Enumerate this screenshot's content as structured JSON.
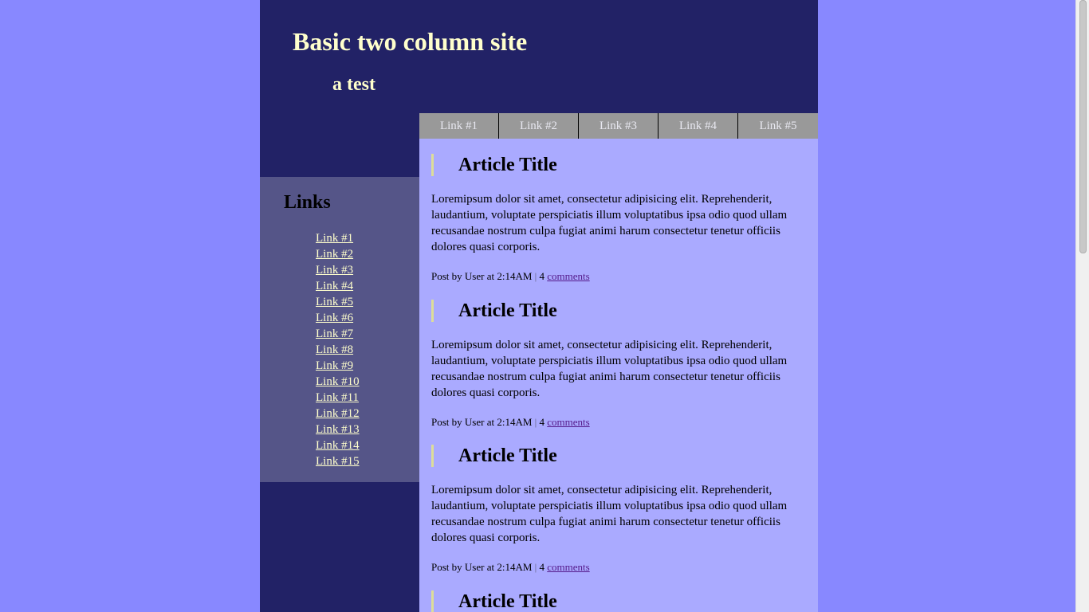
{
  "header": {
    "title": "Basic two column site",
    "subtitle": "a test"
  },
  "navbar": {
    "links": [
      "Link #1",
      "Link #2",
      "Link #3",
      "Link #4",
      "Link #5"
    ]
  },
  "sidebar": {
    "heading": "Links",
    "links": [
      "Link #1",
      "Link #2",
      "Link #3",
      "Link #4",
      "Link #5",
      "Link #6",
      "Link #7",
      "Link #8",
      "Link #9",
      "Link #10",
      "Link #11",
      "Link #12",
      "Link #13",
      "Link #14",
      "Link #15"
    ]
  },
  "articles": [
    {
      "title": "Article Title",
      "body": "Loremipsum dolor sit amet, consectetur adipisicing elit. Reprehenderit, laudantium, voluptate perspiciatis illum voluptatibus ipsa odio quod ullam recusandae nostrum culpa fugiat animi harum consectetur tenetur officiis dolores quasi corporis.",
      "meta_prefix": "Post by User at 2:14AM",
      "separator": "|",
      "comment_count": "4",
      "comments_label": "comments"
    },
    {
      "title": "Article Title",
      "body": "Loremipsum dolor sit amet, consectetur adipisicing elit. Reprehenderit, laudantium, voluptate perspiciatis illum voluptatibus ipsa odio quod ullam recusandae nostrum culpa fugiat animi harum consectetur tenetur officiis dolores quasi corporis.",
      "meta_prefix": "Post by User at 2:14AM",
      "separator": "|",
      "comment_count": "4",
      "comments_label": "comments"
    },
    {
      "title": "Article Title",
      "body": "Loremipsum dolor sit amet, consectetur adipisicing elit. Reprehenderit, laudantium, voluptate perspiciatis illum voluptatibus ipsa odio quod ullam recusandae nostrum culpa fugiat animi harum consectetur tenetur officiis dolores quasi corporis.",
      "meta_prefix": "Post by User at 2:14AM",
      "separator": "|",
      "comment_count": "4",
      "comments_label": "comments"
    },
    {
      "title": "Article Title"
    }
  ],
  "colors": {
    "page_background": "#8888ff",
    "header_background": "#222266",
    "title_text": "#ffffcc",
    "nav_background": "#999999",
    "sidebar_background": "#555588",
    "content_background": "#aaaaff",
    "visited_link": "#551a8b"
  }
}
